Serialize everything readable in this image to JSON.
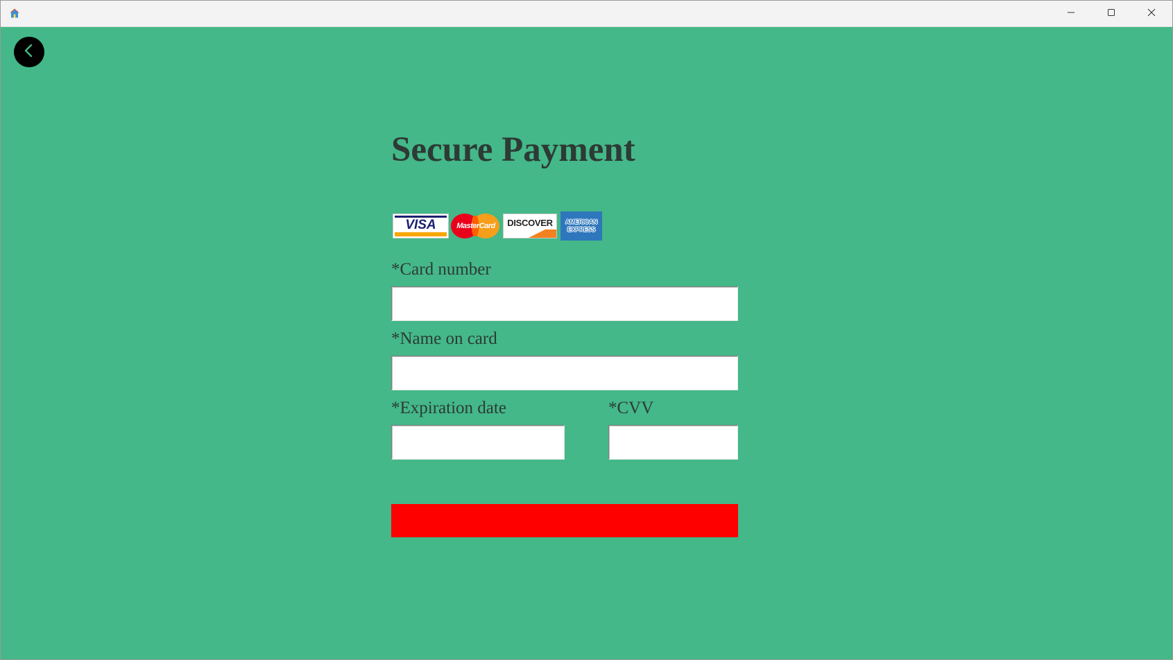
{
  "window": {
    "app_icon": "home-icon",
    "controls": {
      "minimize_icon": "minimize-icon",
      "maximize_icon": "maximize-icon",
      "close_icon": "close-icon"
    }
  },
  "nav": {
    "back_icon": "chevron-left-icon",
    "back_icon_color": "#44b888"
  },
  "page": {
    "title": "Secure Payment",
    "background_color": "#44b888",
    "text_color": "#2d3a36"
  },
  "card_logos": {
    "visa": "VISA",
    "mastercard": "MasterCard",
    "discover": "DISCOVER",
    "amex_line1": "AMERICAN",
    "amex_line2": "EXPRESS"
  },
  "form": {
    "card_number": {
      "label": "*Card number",
      "value": ""
    },
    "name_on_card": {
      "label": "*Name on card",
      "value": ""
    },
    "expiration_date": {
      "label": "*Expiration date",
      "value": ""
    },
    "cvv": {
      "label": "*CVV",
      "value": ""
    }
  },
  "submit": {
    "label": "",
    "color": "#ff0000"
  }
}
